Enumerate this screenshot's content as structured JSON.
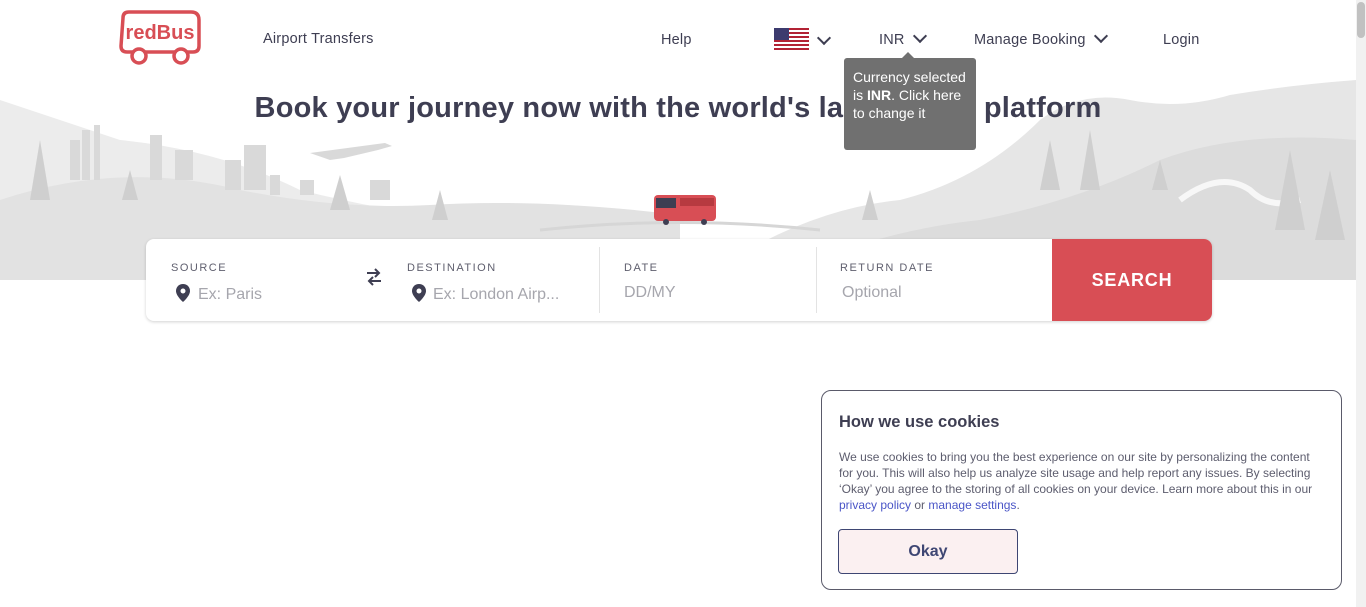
{
  "header": {
    "logo_text": "redBus",
    "airport_transfers": "Airport Transfers",
    "help": "Help",
    "currency": "INR",
    "manage_booking": "Manage Booking",
    "login": "Login"
  },
  "tooltip": {
    "prefix": "Currency selected is ",
    "currency": "INR",
    "suffix": ". Click here to change it"
  },
  "headline": "Book your journey now with the world's largest bus platform",
  "search": {
    "source_label": "SOURCE",
    "source_placeholder": "Ex: Paris",
    "destination_label": "DESTINATION",
    "destination_placeholder": "Ex: London Airp...",
    "date_label": "DATE",
    "date_placeholder": "DD/MY",
    "return_label": "RETURN DATE",
    "return_placeholder": "Optional",
    "button": "SEARCH"
  },
  "cookie": {
    "title": "How we use cookies",
    "body": "We use cookies to bring you the best experience on our site by personalizing the content for you. This will also help us analyze site usage and help report any issues. By selecting ‘Okay’ you agree to the storing of all cookies on your device. Learn more about this in our ",
    "privacy_link": "privacy policy",
    "or": " or ",
    "settings_link": "manage settings",
    "end": ".",
    "okay": "Okay"
  },
  "colors": {
    "brand_red": "#d84e55",
    "text_dark": "#3e3e52",
    "link_blue": "#4a55c7"
  },
  "icons": {
    "flag": "us-flag-icon",
    "swap": "swap-icon",
    "location": "location-pin-icon"
  }
}
